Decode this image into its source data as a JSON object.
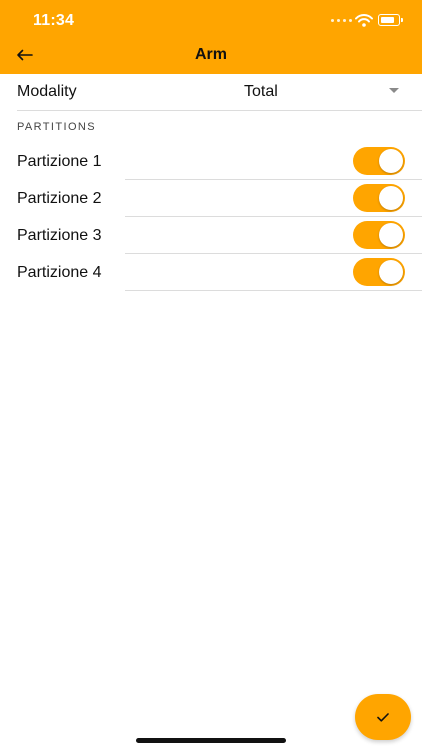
{
  "status_bar": {
    "time": "11:34"
  },
  "header": {
    "title": "Arm",
    "back_icon": "arrow-left-icon"
  },
  "colors": {
    "accent": "#FFA500",
    "divider": "#dcdcdc"
  },
  "modality": {
    "label": "Modality",
    "value": "Total"
  },
  "partitions_section": {
    "title": "PARTITIONS",
    "items": [
      {
        "label": "Partizione 1",
        "enabled": true
      },
      {
        "label": "Partizione 2",
        "enabled": true
      },
      {
        "label": "Partizione 3",
        "enabled": true
      },
      {
        "label": "Partizione 4",
        "enabled": true
      }
    ]
  },
  "fab": {
    "icon": "checkmark-icon"
  }
}
